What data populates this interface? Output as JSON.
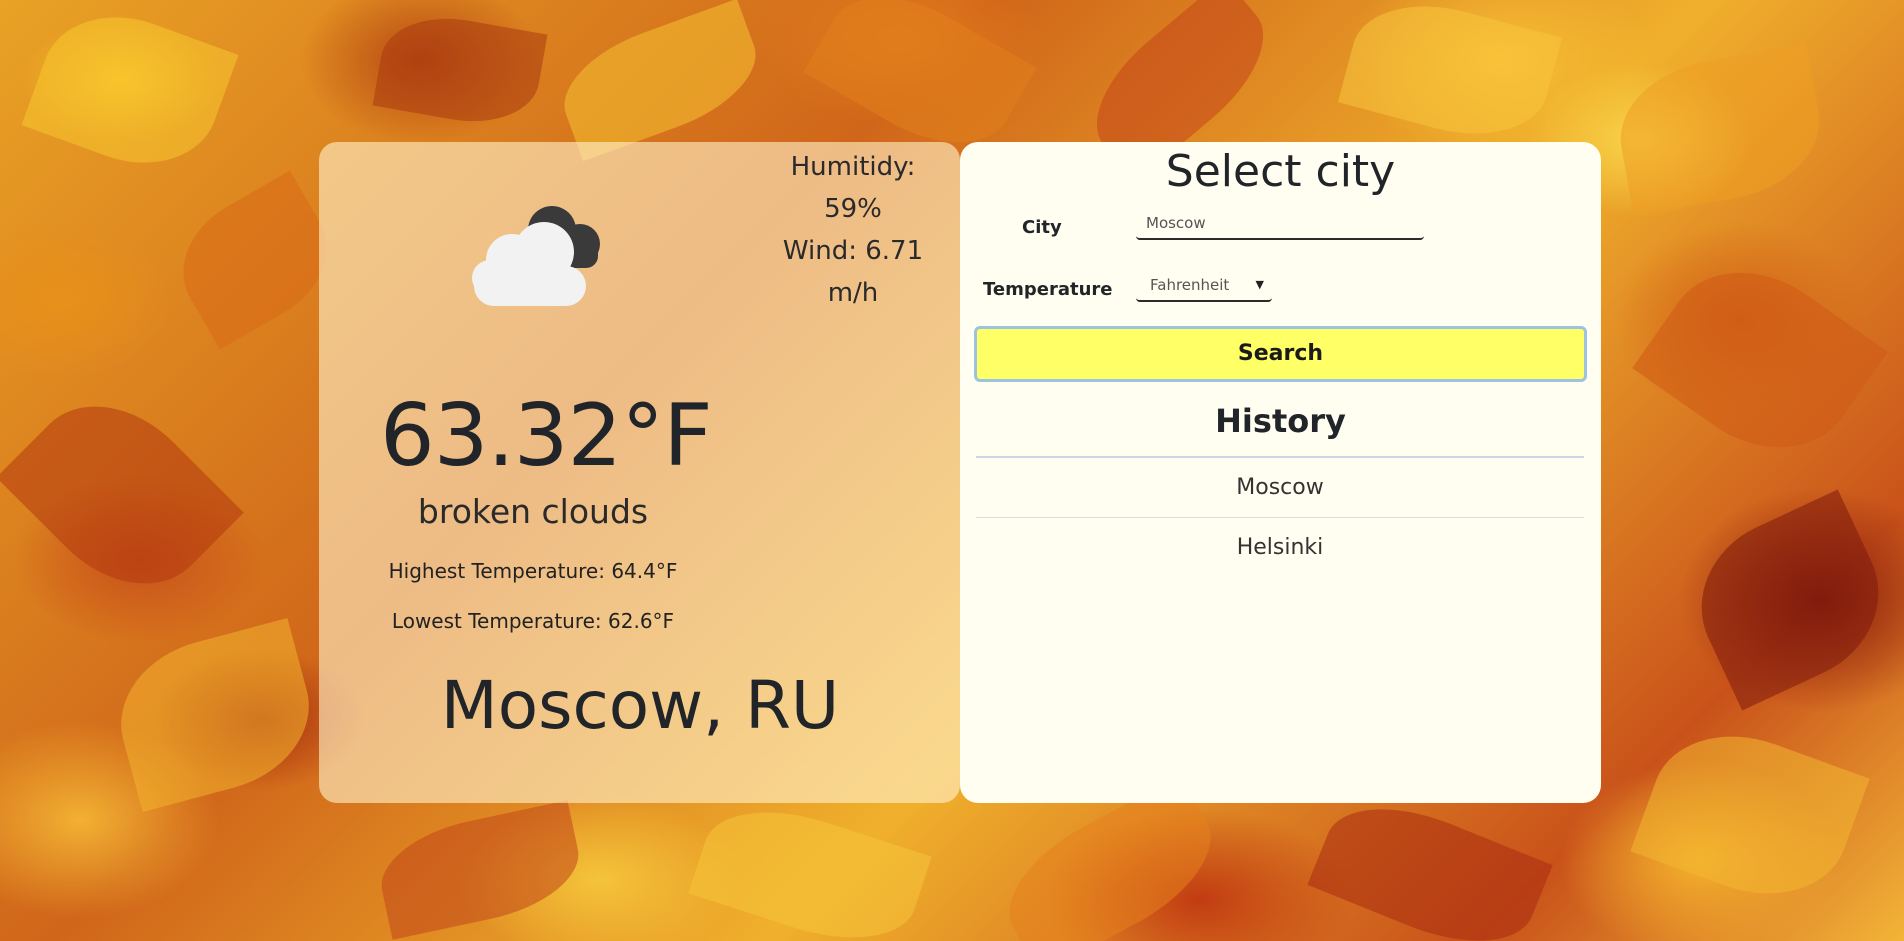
{
  "weather": {
    "icon": "broken-clouds-icon",
    "humidity_label": "Humitidy:",
    "humidity_value": "59%",
    "wind_label": "Wind:",
    "wind_value": "6.71",
    "wind_unit": "m/h",
    "temperature": "63.32°F",
    "description": "broken clouds",
    "highest": "Highest Temperature: 64.4°F",
    "lowest": "Lowest Temperature: 62.6°F",
    "location": "Moscow, RU"
  },
  "search": {
    "title": "Select city",
    "city_label": "City",
    "city_value": "Moscow",
    "temperature_label": "Temperature",
    "unit_selected": "Fahrenheit",
    "button_label": "Search"
  },
  "history": {
    "title": "History",
    "items": [
      "Moscow",
      "Helsinki"
    ]
  },
  "colors": {
    "button": "#ffff66",
    "panel": "#fffef0",
    "card_overlay": "#fff0c8"
  }
}
